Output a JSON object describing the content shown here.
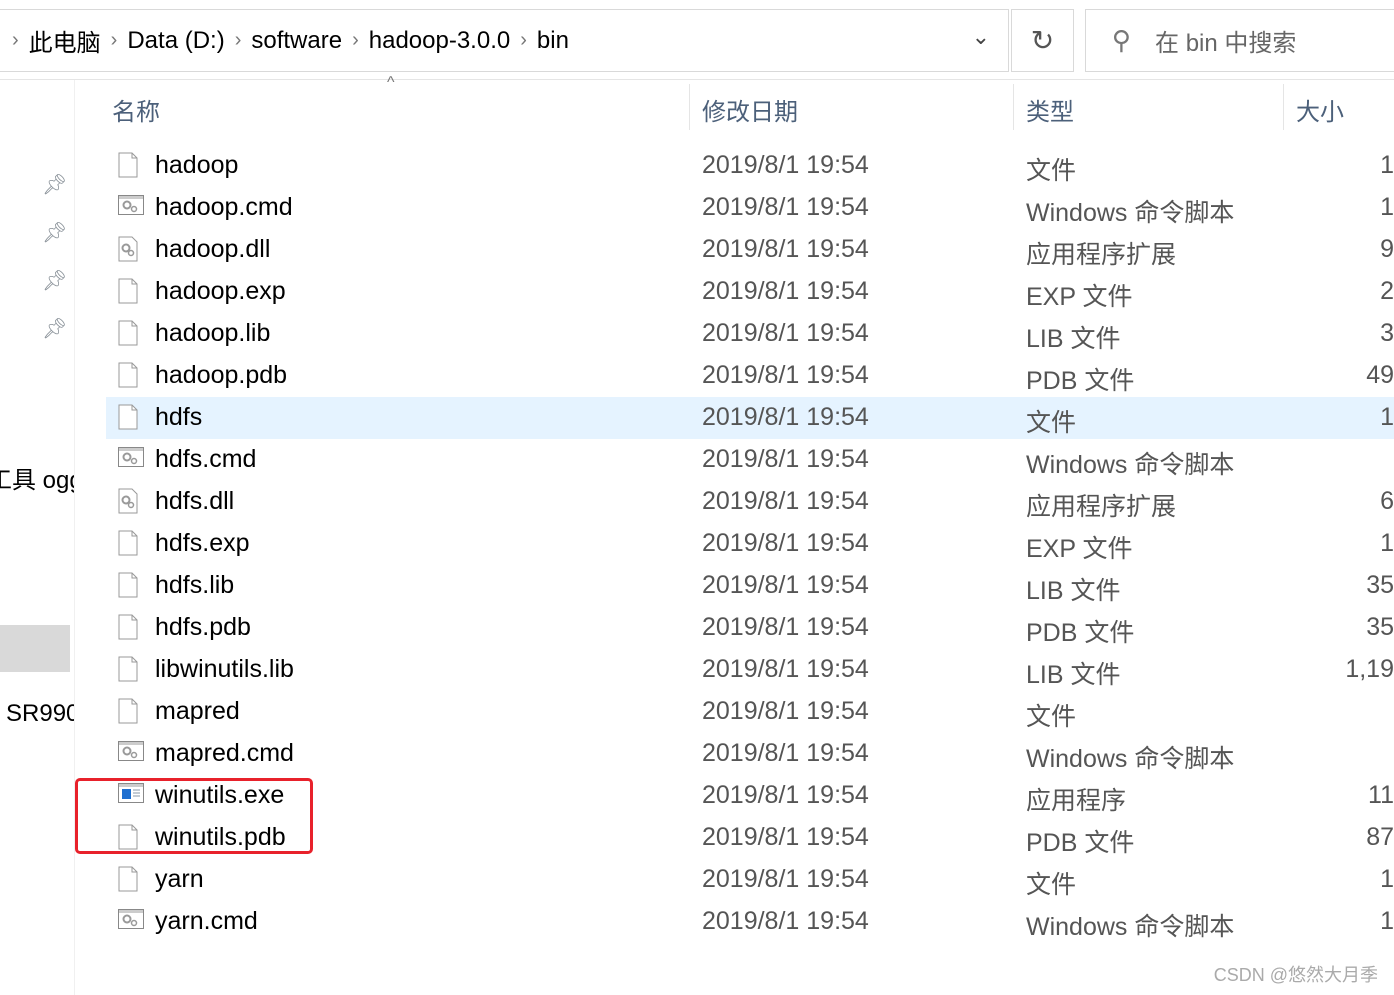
{
  "breadcrumb": [
    "此电脑",
    "Data (D:)",
    "software",
    "hadoop-3.0.0",
    "bin"
  ],
  "search": {
    "placeholder": "在 bin 中搜索"
  },
  "sidebar": {
    "items": [
      "工具 ogg",
      "SR990"
    ]
  },
  "columns": {
    "name": "名称",
    "date": "修改日期",
    "type": "类型",
    "size": "大小"
  },
  "files": [
    {
      "name": "hadoop",
      "date": "2019/8/1 19:54",
      "type": "文件",
      "size": "1",
      "icon": "blank-file"
    },
    {
      "name": "hadoop.cmd",
      "date": "2019/8/1 19:54",
      "type": "Windows 命令脚本",
      "size": "1",
      "icon": "cmd-file"
    },
    {
      "name": "hadoop.dll",
      "date": "2019/8/1 19:54",
      "type": "应用程序扩展",
      "size": "9",
      "icon": "dll-file"
    },
    {
      "name": "hadoop.exp",
      "date": "2019/8/1 19:54",
      "type": "EXP 文件",
      "size": "2",
      "icon": "blank-file"
    },
    {
      "name": "hadoop.lib",
      "date": "2019/8/1 19:54",
      "type": "LIB 文件",
      "size": "3",
      "icon": "blank-file"
    },
    {
      "name": "hadoop.pdb",
      "date": "2019/8/1 19:54",
      "type": "PDB 文件",
      "size": "49",
      "icon": "blank-file"
    },
    {
      "name": "hdfs",
      "date": "2019/8/1 19:54",
      "type": "文件",
      "size": "1",
      "icon": "blank-file",
      "selected": true
    },
    {
      "name": "hdfs.cmd",
      "date": "2019/8/1 19:54",
      "type": "Windows 命令脚本",
      "size": "",
      "icon": "cmd-file"
    },
    {
      "name": "hdfs.dll",
      "date": "2019/8/1 19:54",
      "type": "应用程序扩展",
      "size": "6",
      "icon": "dll-file"
    },
    {
      "name": "hdfs.exp",
      "date": "2019/8/1 19:54",
      "type": "EXP 文件",
      "size": "1",
      "icon": "blank-file"
    },
    {
      "name": "hdfs.lib",
      "date": "2019/8/1 19:54",
      "type": "LIB 文件",
      "size": "35",
      "icon": "blank-file"
    },
    {
      "name": "hdfs.pdb",
      "date": "2019/8/1 19:54",
      "type": "PDB 文件",
      "size": "35",
      "icon": "blank-file"
    },
    {
      "name": "libwinutils.lib",
      "date": "2019/8/1 19:54",
      "type": "LIB 文件",
      "size": "1,19",
      "icon": "blank-file"
    },
    {
      "name": "mapred",
      "date": "2019/8/1 19:54",
      "type": "文件",
      "size": "",
      "icon": "blank-file"
    },
    {
      "name": "mapred.cmd",
      "date": "2019/8/1 19:54",
      "type": "Windows 命令脚本",
      "size": "",
      "icon": "cmd-file"
    },
    {
      "name": "winutils.exe",
      "date": "2019/8/1 19:54",
      "type": "应用程序",
      "size": "11",
      "icon": "exe-file"
    },
    {
      "name": "winutils.pdb",
      "date": "2019/8/1 19:54",
      "type": "PDB 文件",
      "size": "87",
      "icon": "blank-file"
    },
    {
      "name": "yarn",
      "date": "2019/8/1 19:54",
      "type": "文件",
      "size": "1",
      "icon": "blank-file"
    },
    {
      "name": "yarn.cmd",
      "date": "2019/8/1 19:54",
      "type": "Windows 命令脚本",
      "size": "1",
      "icon": "cmd-file"
    }
  ],
  "highlight_color": "#e8212b",
  "watermark": "CSDN @悠然大月季"
}
